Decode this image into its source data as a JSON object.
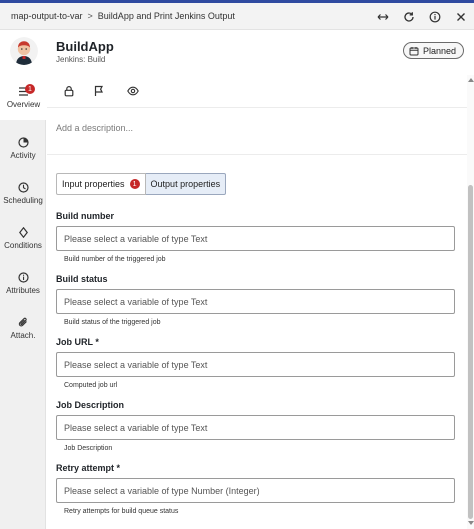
{
  "breadcrumb": {
    "parent": "map-output-to-var",
    "separator": ">",
    "current": "BuildApp and Print Jenkins Output"
  },
  "toolbar_icons": [
    "expand-horizontal-icon",
    "refresh-icon",
    "info-icon",
    "close-icon"
  ],
  "header": {
    "title": "BuildApp",
    "subtitle": "Jenkins: Build",
    "status": "Planned"
  },
  "sidebar": {
    "items": [
      {
        "label": "Overview",
        "icon": "list-icon",
        "badge": "1",
        "active": true
      },
      {
        "label": "Activity",
        "icon": "activity-icon"
      },
      {
        "label": "Scheduling",
        "icon": "clock-icon"
      },
      {
        "label": "Conditions",
        "icon": "diamond-icon"
      },
      {
        "label": "Attributes",
        "icon": "info-icon"
      },
      {
        "label": "Attach.",
        "icon": "paperclip-icon"
      }
    ]
  },
  "actions": [
    "lock-icon",
    "flag-icon",
    "eye-icon"
  ],
  "description": {
    "placeholder": "Add a description..."
  },
  "tabs": [
    {
      "label": "Input properties",
      "badge": "1",
      "active": false
    },
    {
      "label": "Output properties",
      "active": true
    }
  ],
  "fields": [
    {
      "label": "Build number",
      "placeholder": "Please select a variable of type Text",
      "help": "Build number of the triggered job"
    },
    {
      "label": "Build status",
      "placeholder": "Please select a variable of type Text",
      "help": "Build status of the triggered job"
    },
    {
      "label": "Job URL *",
      "placeholder": "Please select a variable of type Text",
      "help": "Computed job url"
    },
    {
      "label": "Job Description",
      "placeholder": "Please select a variable of type Text",
      "help": "Job Description"
    },
    {
      "label": "Retry attempt *",
      "placeholder": "Please select a variable of type Number (Integer)",
      "help": "Retry attempts for build queue status"
    }
  ],
  "colors": {
    "accent": "#2f4aa0",
    "badge": "#c62828",
    "active_tab": "#e6edf7",
    "sidebar_bg": "#f0f0f0"
  }
}
